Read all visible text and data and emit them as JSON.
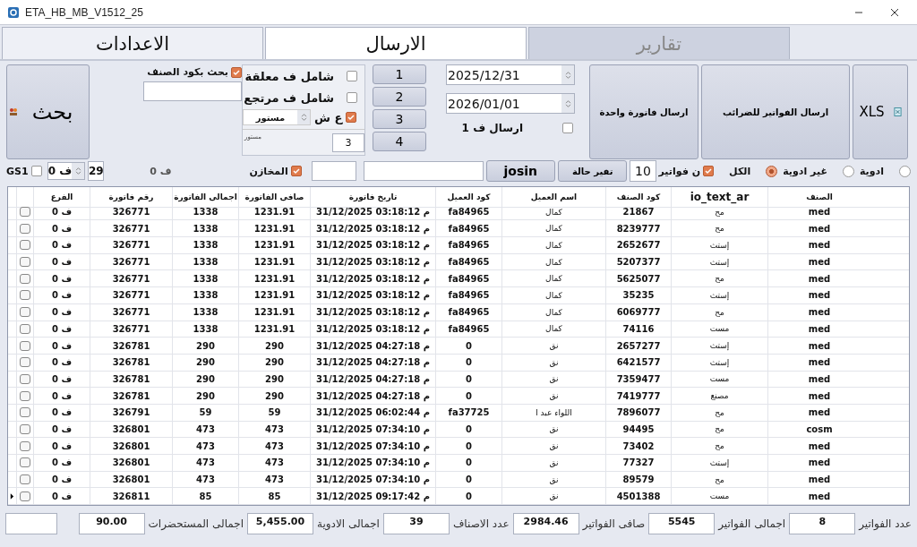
{
  "window": {
    "title": "ETA_HB_MB_V1512_25"
  },
  "tabs": [
    {
      "label": "تقارير",
      "selected": false,
      "disabled": true
    },
    {
      "label": "الارسال",
      "selected": true,
      "disabled": false
    },
    {
      "label": "الاعدادات",
      "selected": false,
      "disabled": false
    }
  ],
  "search_button": {
    "label": "بحث"
  },
  "code_search": {
    "label": "بحث بكود الصنف",
    "checked": true
  },
  "options": [
    {
      "label": "شامل ف معلقة",
      "checked": false
    },
    {
      "label": "شامل ف مرتجع",
      "checked": false
    }
  ],
  "status_filter": {
    "label": "ع ش",
    "checked": true,
    "value": "مستور"
  },
  "status_caption": "مستور",
  "status_count": "3",
  "number_buttons": [
    "1",
    "2",
    "3",
    "4"
  ],
  "dates": [
    "2025/12/31",
    "2026/01/01"
  ],
  "send_one": {
    "label": "ارسال ف 1",
    "checked": false
  },
  "action_buttons": [
    "XLS",
    "ارسال الفواتير للضرائب",
    "ارسال فاتورة واحدة"
  ],
  "filters": {
    "gs1": {
      "label": "GS1",
      "checked": false
    },
    "branch_spinner": "ف 0",
    "count": "29",
    "branch_label": "ف 0",
    "stores": {
      "label": "المخازن",
      "checked": true
    },
    "josin": "josin",
    "change_status": "تفير حالة",
    "invoice_count": "10",
    "invoices": {
      "label": "ن فواتير",
      "checked": true
    },
    "all_label": "الكل",
    "radios": [
      {
        "selected": false
      },
      {
        "label": "ادوية",
        "selected": false
      },
      {
        "label": "غير ادوية",
        "selected": true
      }
    ]
  },
  "table": {
    "columns": [
      "الصنف",
      "io_text_ar",
      "كود الصنف",
      "اسم العميل",
      "كود العميل",
      "تاريخ فاتورة",
      "صافى الفاتورة",
      "اجمالى الفاتورة",
      "رقم فاتورة",
      "الفرع"
    ],
    "rows": [
      {
        "cells": [
          "med",
          "مح",
          "21867",
          "كمال",
          "fa84965",
          "31/12/2025 03:18:12 م",
          "1231.91",
          "1338",
          "326771",
          "ف 0"
        ],
        "checked": false,
        "current": false
      },
      {
        "cells": [
          "med",
          "مح",
          "8239777",
          "كمال",
          "fa84965",
          "31/12/2025 03:18:12 م",
          "1231.91",
          "1338",
          "326771",
          "ف 0"
        ],
        "checked": false,
        "current": false
      },
      {
        "cells": [
          "med",
          "إستث",
          "2652677",
          "كمال",
          "fa84965",
          "31/12/2025 03:18:12 م",
          "1231.91",
          "1338",
          "326771",
          "ف 0"
        ],
        "checked": false,
        "current": false
      },
      {
        "cells": [
          "med",
          "إستث",
          "5207377",
          "كمال",
          "fa84965",
          "31/12/2025 03:18:12 م",
          "1231.91",
          "1338",
          "326771",
          "ف 0"
        ],
        "checked": false,
        "current": false
      },
      {
        "cells": [
          "med",
          "مح",
          "5625077",
          "كمال",
          "fa84965",
          "31/12/2025 03:18:12 م",
          "1231.91",
          "1338",
          "326771",
          "ف 0"
        ],
        "checked": false,
        "current": false
      },
      {
        "cells": [
          "med",
          "إستث",
          "35235",
          "كمال",
          "fa84965",
          "31/12/2025 03:18:12 م",
          "1231.91",
          "1338",
          "326771",
          "ف 0"
        ],
        "checked": false,
        "current": false
      },
      {
        "cells": [
          "med",
          "مح",
          "6069777",
          "كمال",
          "fa84965",
          "31/12/2025 03:18:12 م",
          "1231.91",
          "1338",
          "326771",
          "ف 0"
        ],
        "checked": false,
        "current": false
      },
      {
        "cells": [
          "med",
          "مست",
          "74116",
          "كمال",
          "fa84965",
          "31/12/2025 03:18:12 م",
          "1231.91",
          "1338",
          "326771",
          "ف 0"
        ],
        "checked": false,
        "current": false
      },
      {
        "cells": [
          "med",
          "إستث",
          "2657277",
          "نق",
          "0",
          "31/12/2025 04:27:18 م",
          "290",
          "290",
          "326781",
          "ف 0"
        ],
        "checked": false,
        "current": false
      },
      {
        "cells": [
          "med",
          "إستث",
          "6421577",
          "نق",
          "0",
          "31/12/2025 04:27:18 م",
          "290",
          "290",
          "326781",
          "ف 0"
        ],
        "checked": false,
        "current": false
      },
      {
        "cells": [
          "med",
          "مست",
          "7359477",
          "نق",
          "0",
          "31/12/2025 04:27:18 م",
          "290",
          "290",
          "326781",
          "ف 0"
        ],
        "checked": false,
        "current": false
      },
      {
        "cells": [
          "med",
          "مصنع",
          "7419777",
          "نق",
          "0",
          "31/12/2025 04:27:18 م",
          "290",
          "290",
          "326781",
          "ف 0"
        ],
        "checked": false,
        "current": false
      },
      {
        "cells": [
          "med",
          "مح",
          "7896077",
          "اللواء عبد ا",
          "fa37725",
          "31/12/2025 06:02:44 م",
          "59",
          "59",
          "326791",
          "ف 0"
        ],
        "checked": false,
        "current": false
      },
      {
        "cells": [
          "cosm",
          "مح",
          "94495",
          "نق",
          "0",
          "31/12/2025 07:34:10 م",
          "473",
          "473",
          "326801",
          "ف 0"
        ],
        "checked": false,
        "current": false
      },
      {
        "cells": [
          "med",
          "مح",
          "73402",
          "نق",
          "0",
          "31/12/2025 07:34:10 م",
          "473",
          "473",
          "326801",
          "ف 0"
        ],
        "checked": false,
        "current": false
      },
      {
        "cells": [
          "med",
          "إستث",
          "77327",
          "نق",
          "0",
          "31/12/2025 07:34:10 م",
          "473",
          "473",
          "326801",
          "ف 0"
        ],
        "checked": false,
        "current": false
      },
      {
        "cells": [
          "med",
          "مح",
          "89579",
          "نق",
          "0",
          "31/12/2025 07:34:10 م",
          "473",
          "473",
          "326801",
          "ف 0"
        ],
        "checked": false,
        "current": false
      },
      {
        "cells": [
          "med",
          "مست",
          "4501388",
          "نق",
          "0",
          "31/12/2025 09:17:42 م",
          "85",
          "85",
          "326811",
          "ف 0"
        ],
        "checked": false,
        "current": true
      }
    ]
  },
  "totals": [
    {
      "label": "عدد الفواتير",
      "value": "8"
    },
    {
      "label": "اجمالى الفواتير",
      "value": "5545"
    },
    {
      "label": "صافى الفواتير",
      "value": "2984.46"
    },
    {
      "label": "عدد الاصناف",
      "value": "39"
    },
    {
      "label": "اجمالى الادوية",
      "value": "5,455.00"
    },
    {
      "label": "اجمالى المستحضرات",
      "value": "90.00"
    }
  ]
}
